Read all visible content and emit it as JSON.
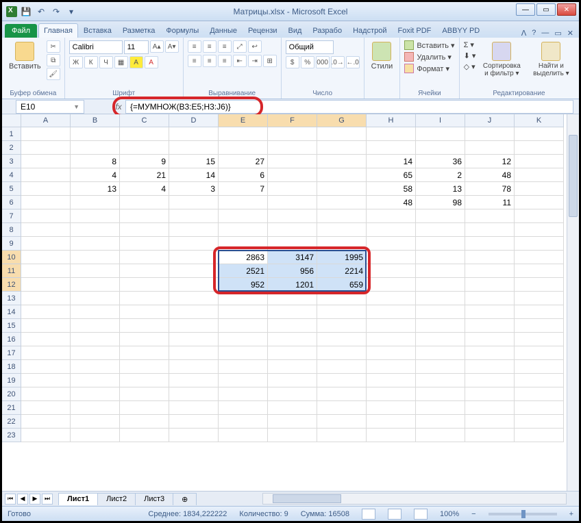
{
  "title": "Матрицы.xlsx - Microsoft Excel",
  "qat": {
    "save": "💾",
    "undo": "↶",
    "redo": "↷"
  },
  "tabs": {
    "file": "Файл",
    "items": [
      "Главная",
      "Вставка",
      "Разметка",
      "Формулы",
      "Данные",
      "Рецензи",
      "Вид",
      "Разрабо",
      "Надстрой",
      "Foxit PDF",
      "ABBYY PD"
    ],
    "active_index": 0
  },
  "ribbon": {
    "clipboard": {
      "paste": "Вставить",
      "label": "Буфер обмена"
    },
    "font": {
      "name": "Calibri",
      "size": "11",
      "bold": "Ж",
      "italic": "К",
      "underline": "Ч",
      "label": "Шрифт"
    },
    "alignment": {
      "label": "Выравнивание"
    },
    "number": {
      "format": "Общий",
      "label": "Число"
    },
    "styles": {
      "btn": "Стили"
    },
    "cells": {
      "insert": "Вставить ▾",
      "delete": "Удалить ▾",
      "format": "Формат ▾",
      "label": "Ячейки"
    },
    "editing": {
      "sigma": "Σ ▾",
      "fill": "⬇ ▾",
      "clear": "◇ ▾",
      "sort": "Сортировка и фильтр ▾",
      "find": "Найти и выделить ▾",
      "label": "Редактирование"
    }
  },
  "namebox": "E10",
  "formula": "{=МУМНОЖ(B3:E5;H3:J6)}",
  "columns": [
    "A",
    "B",
    "C",
    "D",
    "E",
    "F",
    "G",
    "H",
    "I",
    "J",
    "K"
  ],
  "rows": [
    "1",
    "2",
    "3",
    "4",
    "5",
    "6",
    "7",
    "8",
    "9",
    "10",
    "11",
    "12",
    "13",
    "14",
    "15",
    "16",
    "17",
    "18",
    "19",
    "20",
    "21",
    "22",
    "23"
  ],
  "selected_cols": [
    4,
    5,
    6
  ],
  "selected_rows": [
    9,
    10,
    11
  ],
  "data": {
    "r3": {
      "B": "8",
      "C": "9",
      "D": "15",
      "E": "27",
      "H": "14",
      "I": "36",
      "J": "12"
    },
    "r4": {
      "B": "4",
      "C": "21",
      "D": "14",
      "E": "6",
      "H": "65",
      "I": "2",
      "J": "48"
    },
    "r5": {
      "B": "13",
      "C": "4",
      "D": "3",
      "E": "7",
      "H": "58",
      "I": "13",
      "J": "78"
    },
    "r6": {
      "H": "48",
      "I": "98",
      "J": "11"
    },
    "r10": {
      "E": "2863",
      "F": "3147",
      "G": "1995"
    },
    "r11": {
      "E": "2521",
      "F": "956",
      "G": "2214"
    },
    "r12": {
      "E": "952",
      "F": "1201",
      "G": "659"
    }
  },
  "sheets": {
    "items": [
      "Лист1",
      "Лист2",
      "Лист3"
    ],
    "active": 0,
    "addnew": "⊕"
  },
  "status": {
    "ready": "Готово",
    "avg": "Среднее: 1834,222222",
    "count": "Количество: 9",
    "sum": "Сумма: 16508",
    "zoom": "100%"
  }
}
